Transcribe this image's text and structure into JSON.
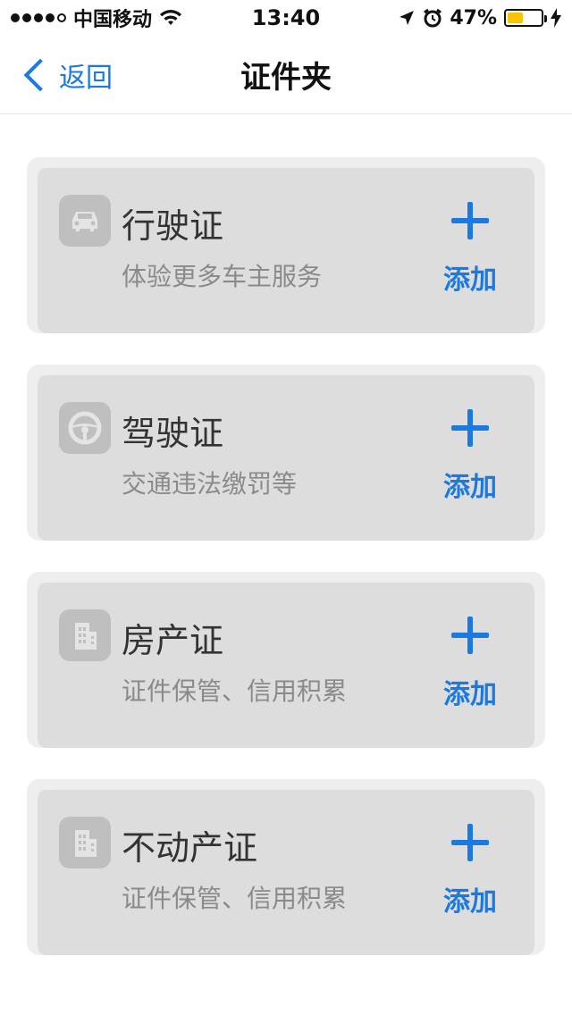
{
  "status_bar": {
    "carrier": "中国移动",
    "time": "13:40",
    "battery_percent": "47%",
    "battery_level": 0.47,
    "icons": [
      "signal-dots-icon",
      "wifi-icon",
      "location-arrow-icon",
      "alarm-icon",
      "battery-icon",
      "charging-icon"
    ]
  },
  "nav": {
    "back_label": "返回",
    "title": "证件夹"
  },
  "cards": [
    {
      "title": "行驶证",
      "subtitle": "体验更多车主服务",
      "add_label": "添加",
      "icon": "car-icon"
    },
    {
      "title": "驾驶证",
      "subtitle": "交通违法缴罚等",
      "add_label": "添加",
      "icon": "steering-wheel-icon"
    },
    {
      "title": "房产证",
      "subtitle": "证件保管、信用积累",
      "add_label": "添加",
      "icon": "building-icon"
    },
    {
      "title": "不动产证",
      "subtitle": "证件保管、信用积累",
      "add_label": "添加",
      "icon": "building-icon"
    }
  ],
  "colors": {
    "accent": "#1a7ae0",
    "card_bg": "#dddddd",
    "card_outer": "#eeeeee",
    "battery_fill": "#f6c400"
  }
}
